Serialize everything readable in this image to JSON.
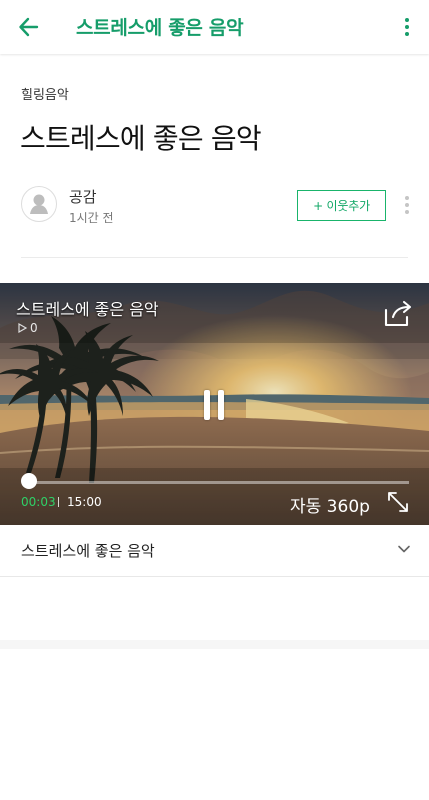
{
  "header": {
    "title": "스트레스에 좋은 음악"
  },
  "post": {
    "category": "힐링음악",
    "title": "스트레스에 좋은 음악",
    "author_name": "공감",
    "time": "1시간 전",
    "neighbor_button": "+ 이웃추가"
  },
  "video": {
    "title": "스트레스에 좋은 음악",
    "play_count": "0",
    "current_time": "00:03",
    "duration": "15:00",
    "quality": "자동 360p",
    "progress": 0.003
  },
  "caption": {
    "text": "스트레스에 좋은 음악"
  },
  "colors": {
    "accent": "#169d6a",
    "button_border": "#19b46b",
    "time_green": "#2fd067"
  },
  "icons": [
    "back-arrow-icon",
    "more-icon",
    "avatar-icon",
    "play-count-icon",
    "share-icon",
    "pause-icon",
    "fullscreen-icon",
    "chevron-down-icon"
  ]
}
